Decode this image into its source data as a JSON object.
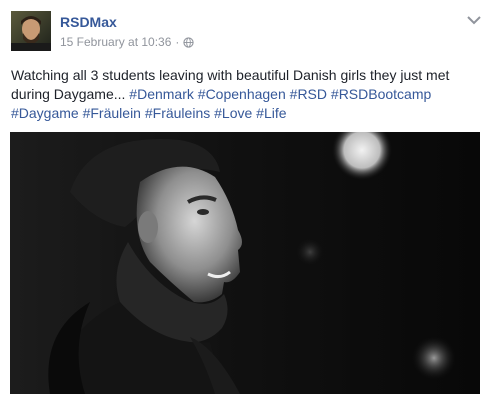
{
  "post": {
    "author": "RSDMax",
    "date": "15 February at 10:36",
    "separator": "·",
    "message_text": "Watching all 3 students leaving with beautiful Danish girls they just met during Daygame...",
    "hashtags": [
      "#Denmark",
      "#Copenhagen",
      "#RSD",
      "#RSDBootcamp",
      "#Daygame",
      "#Fräulein",
      "#Fräuleins",
      "#Love",
      "#Life"
    ]
  },
  "icons": {
    "audience": "globe-icon",
    "menu": "chevron-down-icon"
  },
  "colors": {
    "link": "#365899",
    "meta": "#90949c",
    "text": "#1d2129"
  }
}
